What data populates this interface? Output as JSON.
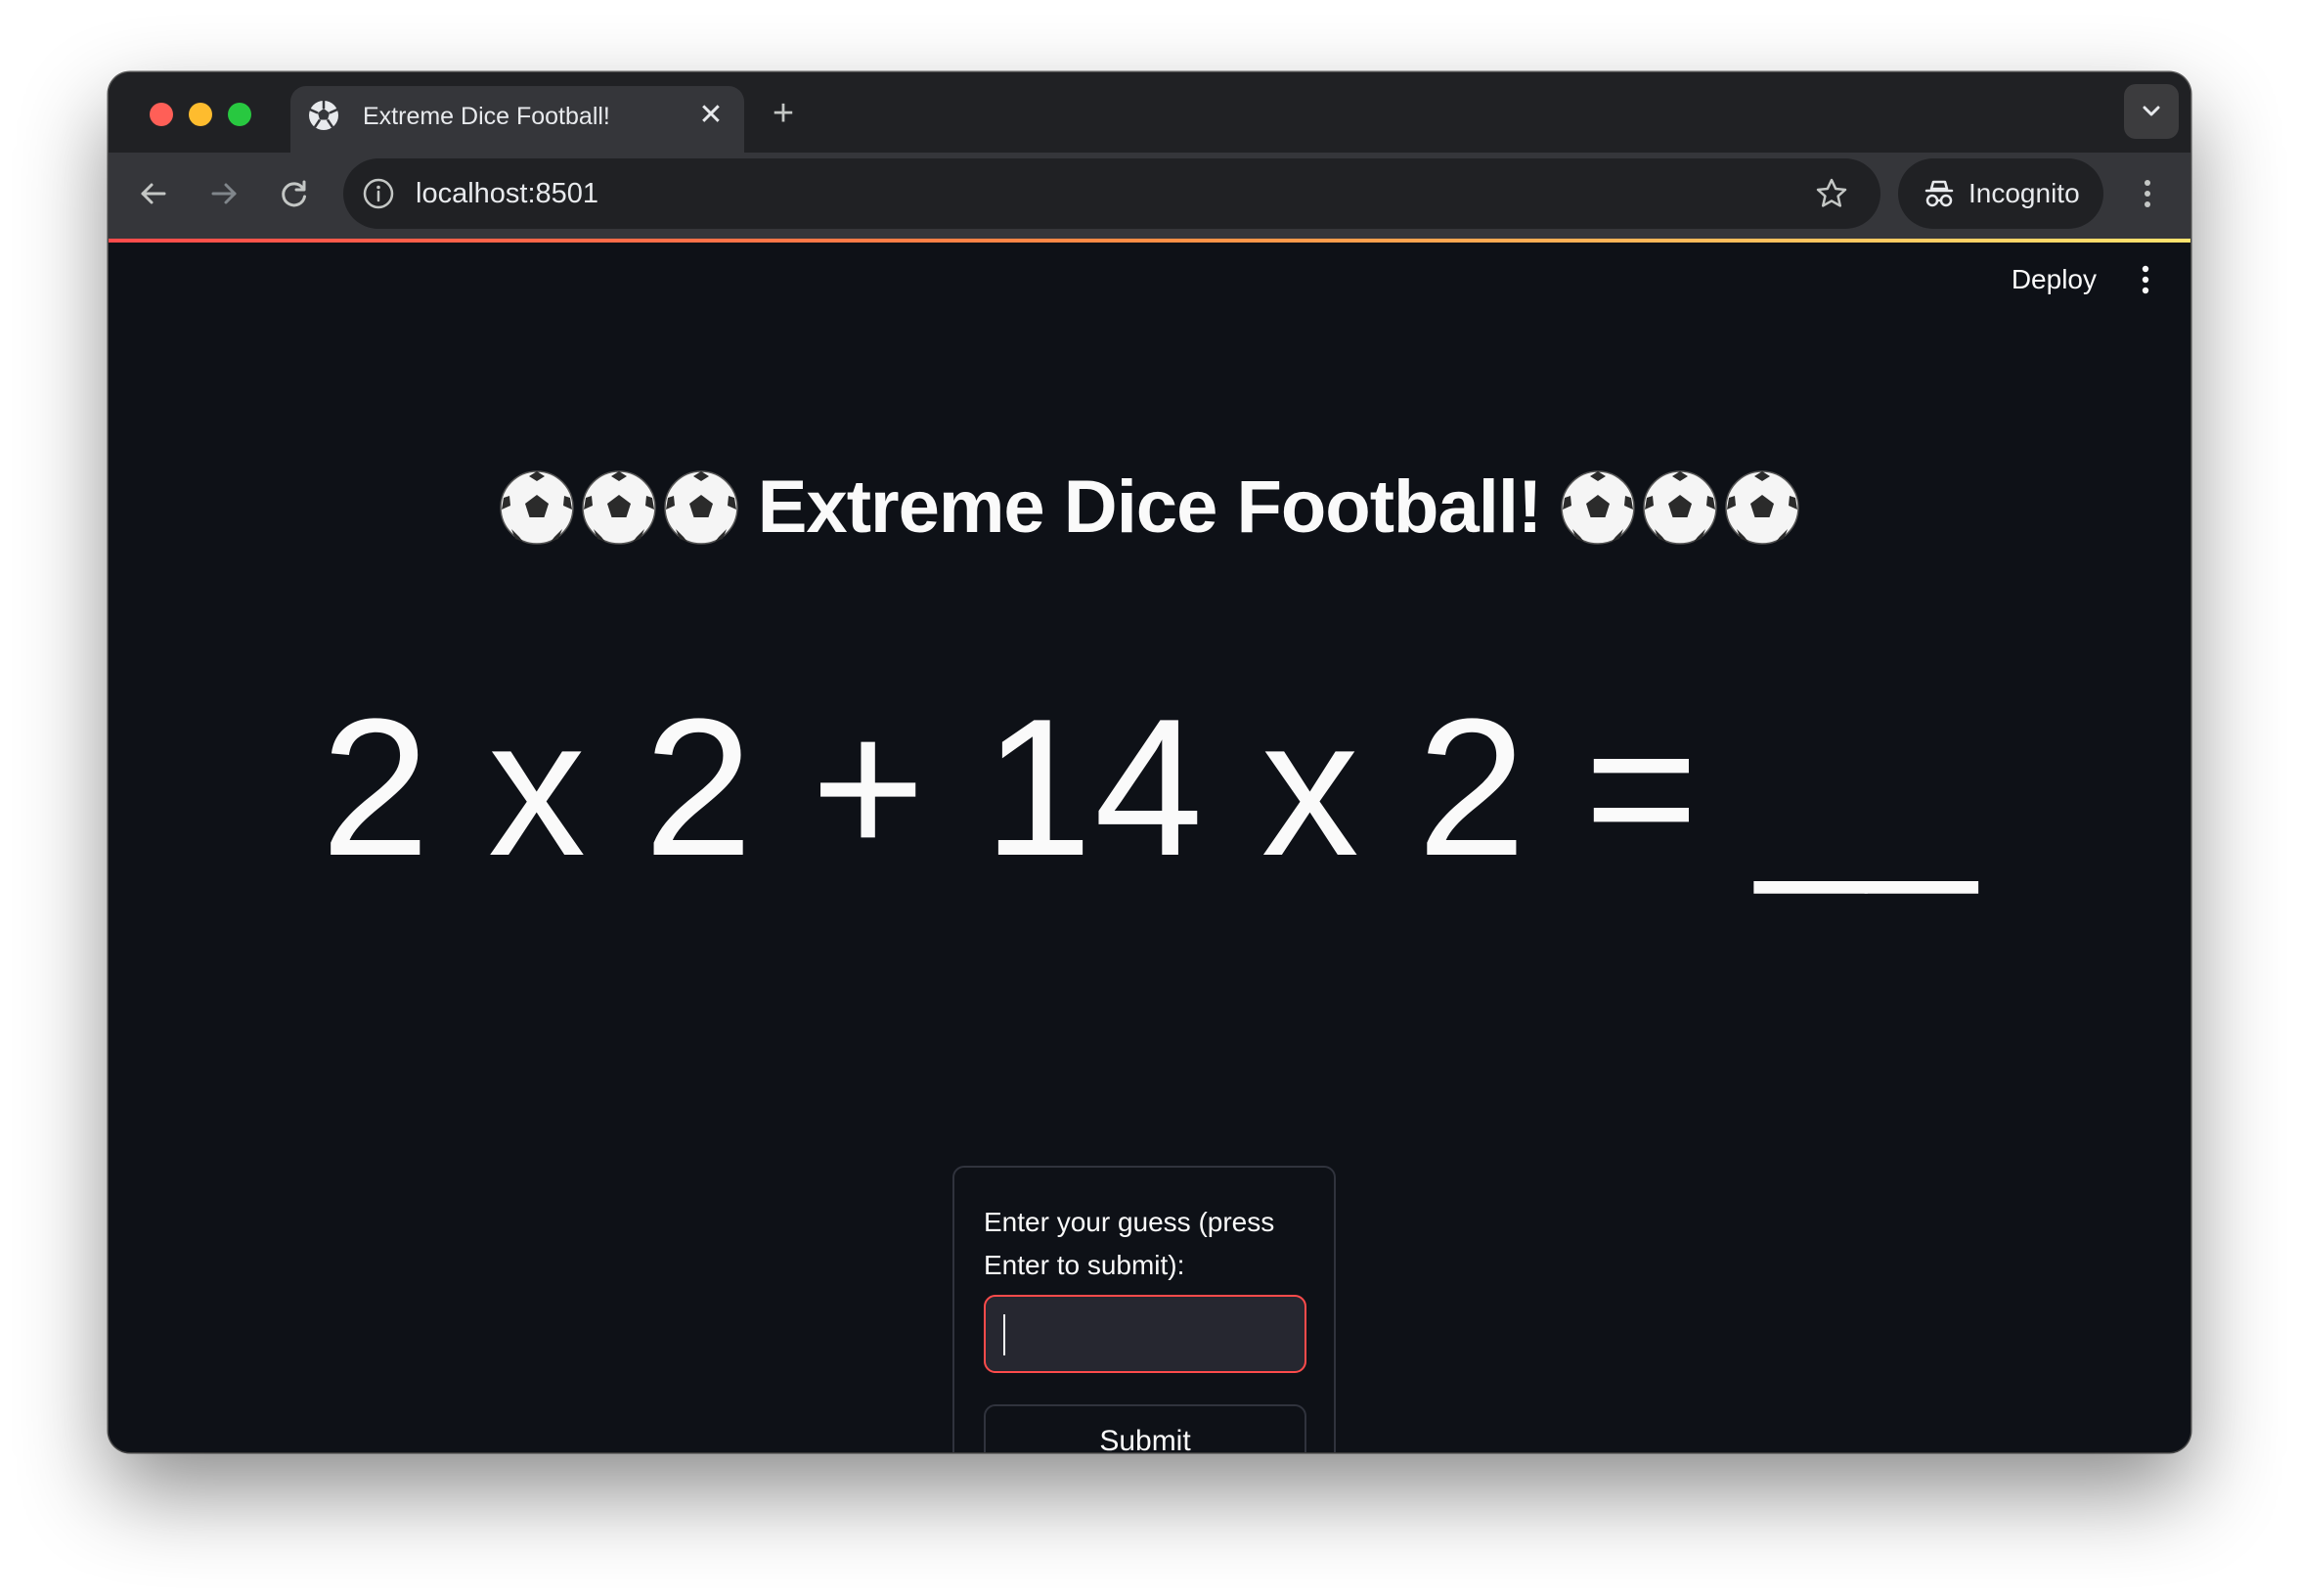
{
  "browser": {
    "tab_title": "Extreme Dice Football!",
    "tab_close": "✕",
    "new_tab": "+",
    "url": "localhost:8501",
    "incognito_label": "Incognito"
  },
  "app": {
    "deploy_label": "Deploy",
    "title": "Extreme Dice Football!",
    "title_icon": "soccer-ball-icon",
    "equation": "2 x 2 + 14 x 2 = __",
    "form": {
      "label": "Enter your guess (press Enter to submit):",
      "input_value": "",
      "submit_label": "Submit"
    }
  },
  "colors": {
    "background": "#0e1117",
    "accent": "#ff4b4b",
    "text": "#fafafa"
  }
}
